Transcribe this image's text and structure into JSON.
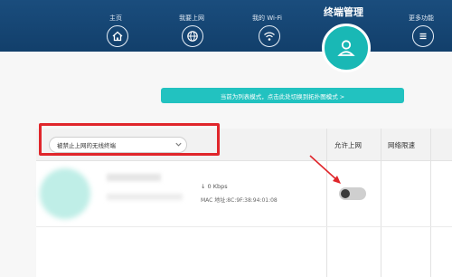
{
  "nav": {
    "items": [
      {
        "label": "主页",
        "icon": "home-icon"
      },
      {
        "label": "我要上网",
        "icon": "globe-icon"
      },
      {
        "label": "我的 Wi-Fi",
        "icon": "wifi-icon"
      },
      {
        "label": "更多功能",
        "icon": "menu-icon"
      }
    ],
    "active": {
      "label": "终端管理",
      "icon": "user-icon"
    }
  },
  "banner": {
    "text": "当前为列表模式，点击此处切换到拓扑图模式 >"
  },
  "table": {
    "filter": {
      "selected": "被禁止上网的无线终端"
    },
    "columns": [
      "允许上网",
      "网络限速"
    ],
    "rows": [
      {
        "speed": "↓ 0 Kbps",
        "mac": "MAC 地址:8C:9F:38:94:01:08",
        "internet_allowed": false
      }
    ]
  },
  "colors": {
    "header": "#123f6b",
    "accent": "#22c2c0",
    "highlight": "#e0262b"
  }
}
